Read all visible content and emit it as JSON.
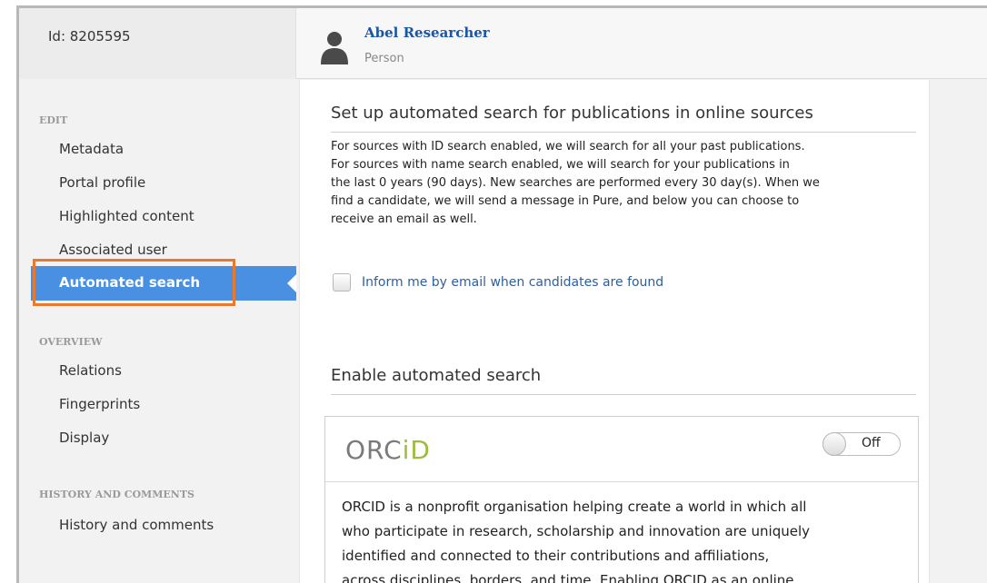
{
  "header": {
    "id_label": "Id: 8205595",
    "person_name": "Abel Researcher",
    "person_type": "Person",
    "person_icon": "person-silhouette-icon"
  },
  "sidebar": {
    "sections": [
      {
        "label": "EDIT",
        "items": [
          "Metadata",
          "Portal profile",
          "Highlighted content",
          "Associated user",
          "Automated search"
        ]
      },
      {
        "label": "OVERVIEW",
        "items": [
          "Relations",
          "Fingerprints",
          "Display"
        ]
      },
      {
        "label": "HISTORY AND COMMENTS",
        "items": [
          "History and comments"
        ]
      }
    ],
    "active_item": "Automated search",
    "active_color": "#4a90e2",
    "highlight_color": "#e87a2e"
  },
  "main": {
    "setup_title": "Set up automated search for publications in online sources",
    "setup_lines": [
      "For sources with ID search enabled, we will search for all your past publications.",
      "For sources with name search enabled, we will search for your publications in",
      "the last 0 years (90 days). New searches are performed every 30 day(s). When we",
      "find a candidate, we will send a message in Pure, and below you can choose to",
      "receive an email as well."
    ],
    "email_checkbox_label": "Inform me by email when candidates are found",
    "email_checkbox_checked": false,
    "enable_title": "Enable automated search",
    "orcid": {
      "logo_text_prefix": "ORC",
      "logo_text_suffix": "iD",
      "toggle_label": "Off",
      "toggle_state": "off",
      "description_lines": [
        "ORCID is a nonprofit organisation helping create a world in which all",
        "who participate in research, scholarship and innovation are uniquely",
        "identified and connected to their contributions and affiliations,",
        "across disciplines, borders, and time. Enabling ORCID as an online"
      ]
    }
  }
}
